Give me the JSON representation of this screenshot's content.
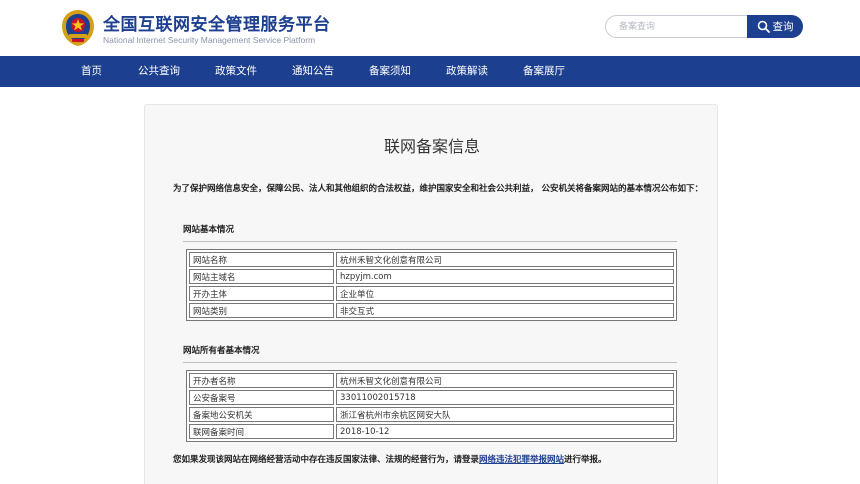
{
  "header": {
    "title": "全国互联网安全管理服务平台",
    "subtitle": "National Internet Security Management Service Platform",
    "logo_icon": "police-emblem-icon",
    "search": {
      "placeholder": "备案查询",
      "value": "",
      "button_label": "查询",
      "icon": "search-icon"
    }
  },
  "nav": {
    "items": [
      "首页",
      "公共查询",
      "政策文件",
      "通知公告",
      "备案须知",
      "政策解读",
      "备案展厅"
    ]
  },
  "card": {
    "title": "联网备案信息",
    "intro": "为了保护网络信息安全，保障公民、法人和其他组织的合法权益，维护国家安全和社会公共利益， 公安机关将备案网站的基本情况公布如下：",
    "site_section": {
      "title": "网站基本情况",
      "rows": [
        {
          "key": "网站名称",
          "value": "杭州禾智文化创意有限公司"
        },
        {
          "key": "网站主域名",
          "value": "hzpyjm.com"
        },
        {
          "key": "开办主体",
          "value": "企业单位"
        },
        {
          "key": "网站类别",
          "value": "非交互式"
        }
      ]
    },
    "owner_section": {
      "title": "网站所有者基本情况",
      "rows": [
        {
          "key": "开办者名称",
          "value": "杭州禾智文化创意有限公司"
        },
        {
          "key": "公安备案号",
          "value": "33011002015718"
        },
        {
          "key": "备案地公安机关",
          "value": "浙江省杭州市余杭区网安大队"
        },
        {
          "key": "联网备案时间",
          "value": "2018-10-12"
        }
      ]
    },
    "footer": {
      "before": "您如果发现该网站在网络经营活动中存在违反国家法律、法规的经营行为，请登录",
      "link": "网络违法犯罪举报网站",
      "after": "进行举报。"
    }
  },
  "colors": {
    "brand_blue": "#1d3f8f",
    "card_bg": "#f7f7f7"
  }
}
